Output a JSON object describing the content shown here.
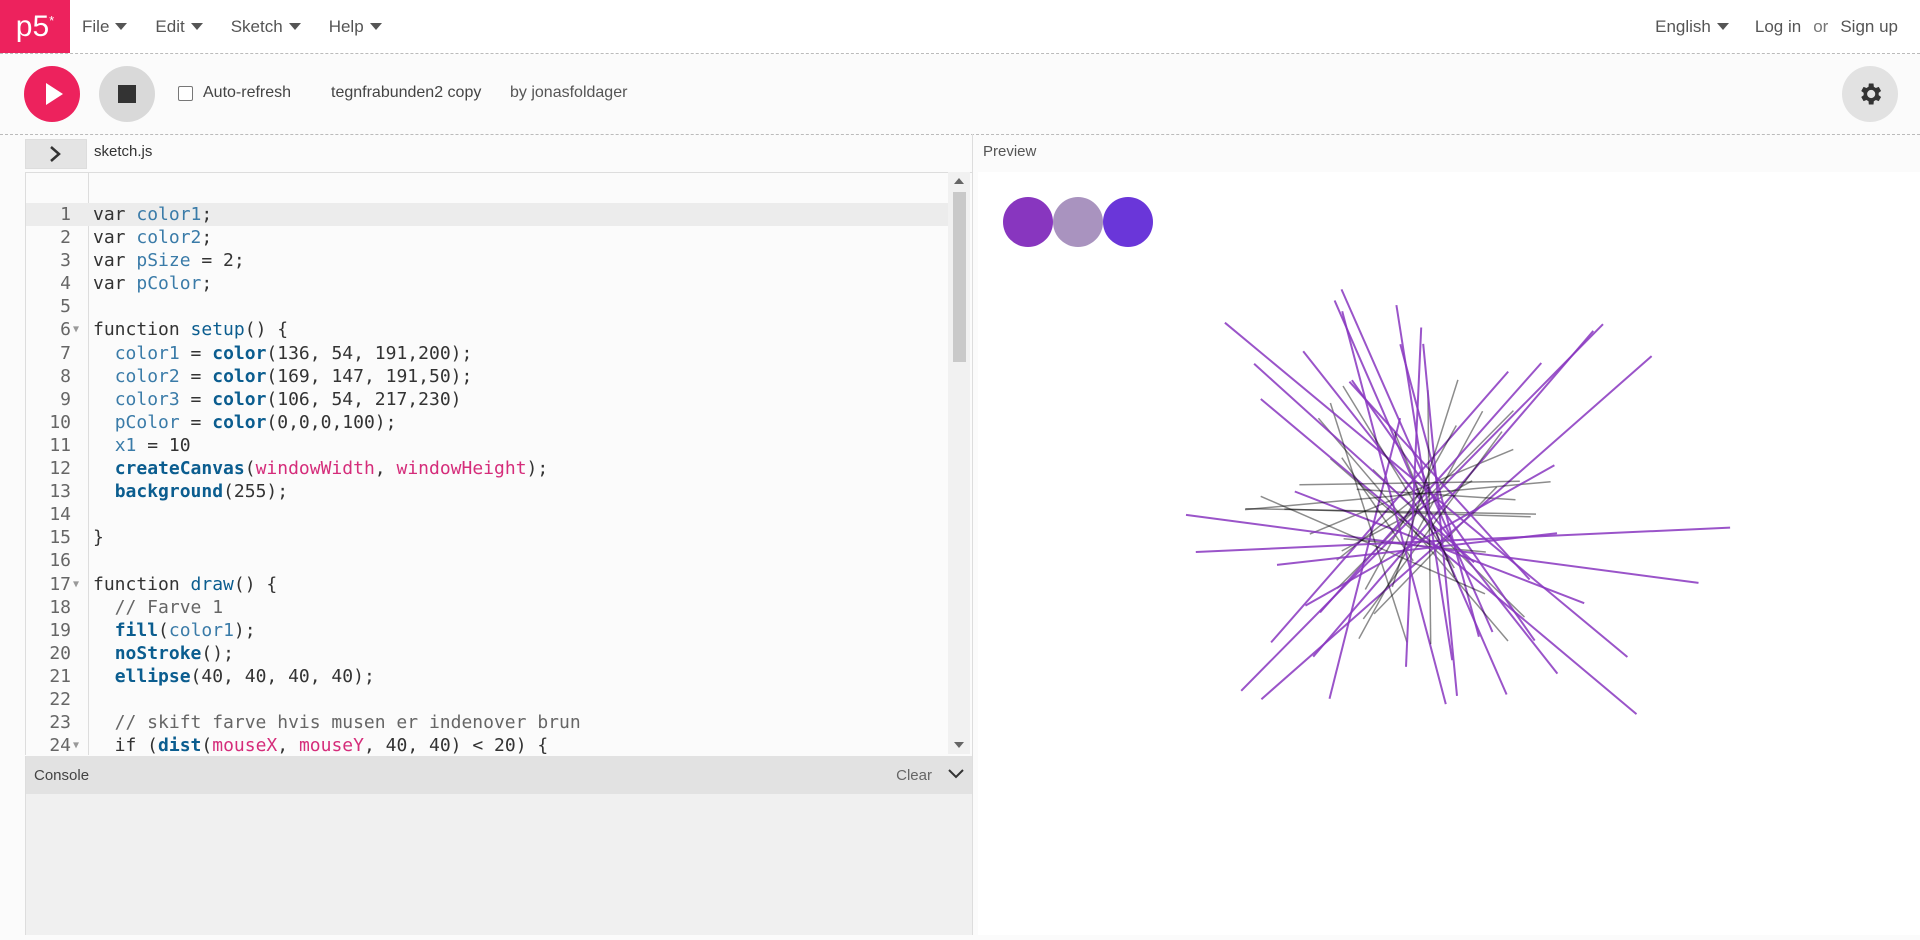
{
  "nav": {
    "logo": "p5",
    "logo_star": "*",
    "menu": [
      "File",
      "Edit",
      "Sketch",
      "Help"
    ],
    "language": "English",
    "login": "Log in",
    "or": "or",
    "signup": "Sign up"
  },
  "toolbar": {
    "autorefresh_label": "Auto-refresh",
    "sketch_name": "tegnfrabunden2 copy",
    "owner": "by jonasfoldager"
  },
  "editor": {
    "file_name": "sketch.js",
    "lines": [
      {
        "n": "1",
        "text": "var color1;"
      },
      {
        "n": "2",
        "text": "var color2;"
      },
      {
        "n": "3",
        "text": "var pSize = 2;"
      },
      {
        "n": "4",
        "text": "var pColor;"
      },
      {
        "n": "5",
        "text": ""
      },
      {
        "n": "6",
        "text": "function setup() {",
        "fold": true
      },
      {
        "n": "7",
        "text": "  color1 = color(136, 54, 191,200);"
      },
      {
        "n": "8",
        "text": "  color2 = color(169, 147, 191,50);"
      },
      {
        "n": "9",
        "text": "  color3 = color(106, 54, 217,230)"
      },
      {
        "n": "10",
        "text": "  pColor = color(0,0,0,100);"
      },
      {
        "n": "11",
        "text": "  x1 = 10"
      },
      {
        "n": "12",
        "text": "  createCanvas(windowWidth, windowHeight);"
      },
      {
        "n": "13",
        "text": "  background(255);"
      },
      {
        "n": "14",
        "text": ""
      },
      {
        "n": "15",
        "text": "}"
      },
      {
        "n": "16",
        "text": ""
      },
      {
        "n": "17",
        "text": "function draw() {",
        "fold": true
      },
      {
        "n": "18",
        "text": "  // Farve 1"
      },
      {
        "n": "19",
        "text": "  fill(color1);"
      },
      {
        "n": "20",
        "text": "  noStroke();"
      },
      {
        "n": "21",
        "text": "  ellipse(40, 40, 40, 40);"
      },
      {
        "n": "22",
        "text": ""
      },
      {
        "n": "23",
        "text": "  // skift farve hvis musen er indenover brun"
      },
      {
        "n": "24",
        "text": "  if (dist(mouseX, mouseY, 40, 40) < 20) {",
        "fold": true
      }
    ]
  },
  "console": {
    "title": "Console",
    "clear": "Clear"
  },
  "preview": {
    "label": "Preview",
    "swatches": [
      "#8836bf",
      "#a993bf",
      "#6a36d9"
    ]
  }
}
